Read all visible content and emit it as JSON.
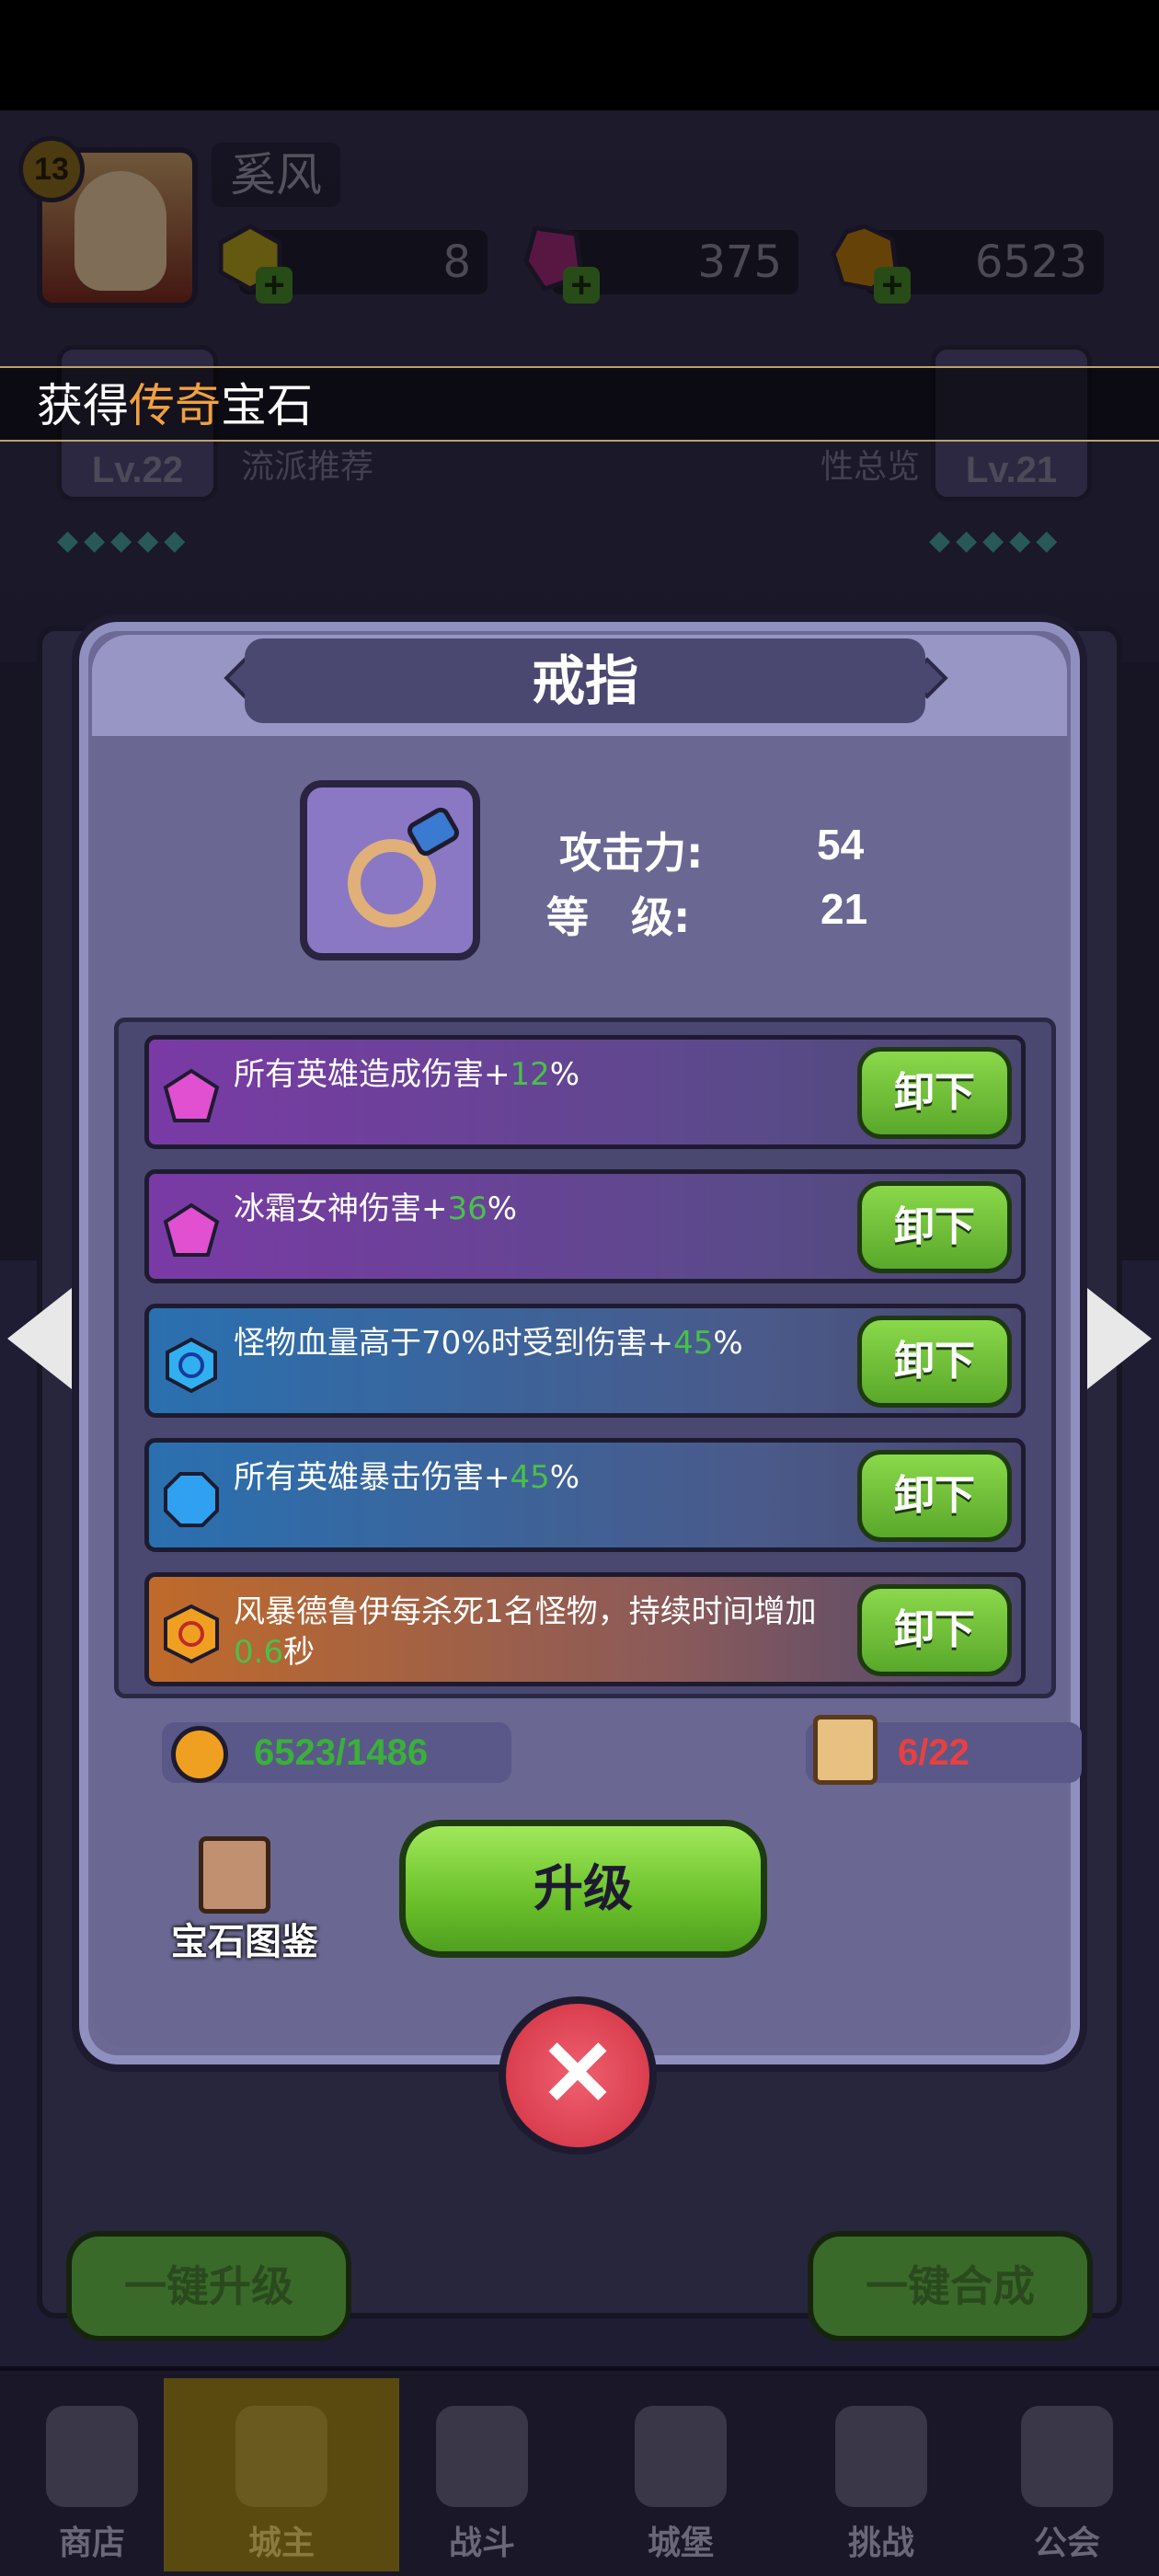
{
  "player": {
    "level": "13",
    "name": "奚风"
  },
  "currencies": [
    {
      "icon": "yellow-gem-icon",
      "value": "8"
    },
    {
      "icon": "pink-crystal-icon",
      "value": "375"
    },
    {
      "icon": "gold-coin-icon",
      "value": "6523"
    }
  ],
  "toast": {
    "prefix": "获得",
    "highlight": "传奇",
    "suffix": "宝石"
  },
  "background": {
    "left_slot_level": "Lv.22",
    "right_slot_level": "Lv.21",
    "left_caption": "流派推荐",
    "right_caption": "性总览",
    "dots": "◆◆◆◆◆"
  },
  "modal": {
    "title": "戒指",
    "item_icon": "ring-icon",
    "stats": [
      {
        "label": "攻击力:",
        "value": "54"
      },
      {
        "label": "等　级:",
        "value": "21"
      }
    ],
    "gems": [
      {
        "color": "purple",
        "icon": "purple-gem-icon",
        "text_before": "所有英雄造成伤害+",
        "number": "12",
        "text_after": "%",
        "button": "卸下"
      },
      {
        "color": "purple",
        "icon": "purple-gem-icon",
        "text_before": "冰霜女神伤害+",
        "number": "36",
        "text_after": "%",
        "button": "卸下"
      },
      {
        "color": "blue",
        "icon": "blue-swirl-gem-icon",
        "text_before": "怪物血量高于70%时受到伤害+",
        "number": "45",
        "text_after": "%",
        "button": "卸下"
      },
      {
        "color": "blue",
        "icon": "blue-gem-icon",
        "text_before": "所有英雄暴击伤害+",
        "number": "45",
        "text_after": "%",
        "button": "卸下"
      },
      {
        "color": "orange",
        "icon": "orange-swirl-gem-icon",
        "text_before": "风暴德鲁伊每杀死1名怪物，持续时间增加",
        "number": "0.6",
        "text_after": "秒",
        "button": "卸下"
      }
    ],
    "coins": "6523/1486",
    "scrolls": "6/22",
    "codex_label": "宝石图鉴",
    "upgrade_label": "升级",
    "close_icon": "close-icon"
  },
  "bottom_buttons": {
    "upgrade_all": "一键升级",
    "merge_all": "一键合成"
  },
  "tabs": [
    {
      "label": "商店",
      "icon": "shop-icon",
      "active": false
    },
    {
      "label": "城主",
      "icon": "crown-icon",
      "active": true
    },
    {
      "label": "战斗",
      "icon": "swords-icon",
      "active": false
    },
    {
      "label": "城堡",
      "icon": "castle-icon",
      "active": false
    },
    {
      "label": "挑战",
      "icon": "demon-icon",
      "active": false
    },
    {
      "label": "公会",
      "icon": "lock-icon",
      "active": false
    }
  ],
  "colors": {
    "highlight_orange": "#f0a040",
    "bonus_green": "#4ac04a",
    "scroll_red": "#e84040",
    "button_green": "#6ac02a",
    "close_red": "#d03040"
  }
}
